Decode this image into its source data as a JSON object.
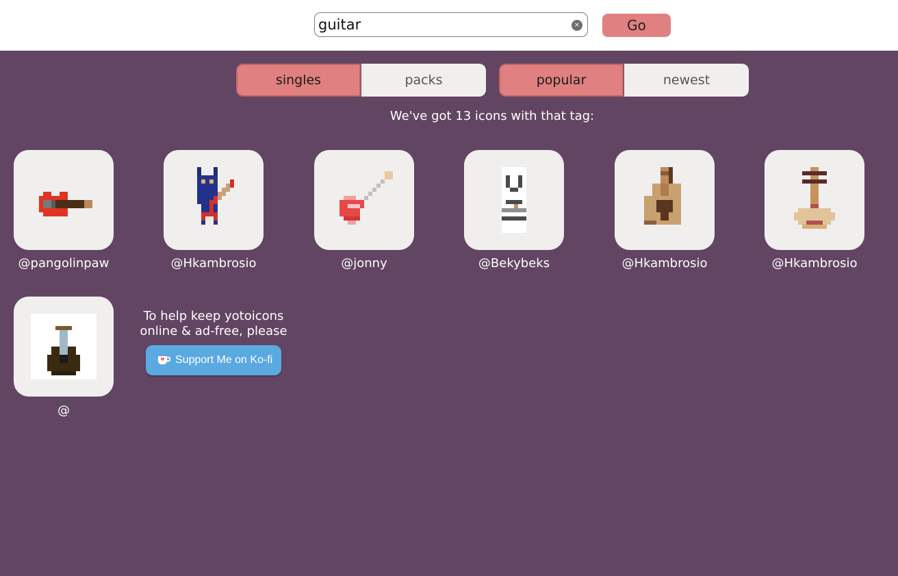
{
  "search": {
    "value": "guitar",
    "clear_icon": "×",
    "go_label": "Go"
  },
  "filters": {
    "kind": [
      {
        "label": "singles",
        "active": true
      },
      {
        "label": "packs",
        "active": false
      }
    ],
    "sort": [
      {
        "label": "popular",
        "active": true
      },
      {
        "label": "newest",
        "active": false
      }
    ]
  },
  "results_text": "We've got 13 icons with that tag:",
  "icons": [
    {
      "author": "@pangolinpaw",
      "icon": "red-electric-guitar-icon"
    },
    {
      "author": "@Hkambrosio",
      "icon": "cat-guitarist-icon"
    },
    {
      "author": "@jonny",
      "icon": "pink-electric-guitar-icon"
    },
    {
      "author": "@Bekybeks",
      "icon": "guitar-neck-icon"
    },
    {
      "author": "@Hkambrosio",
      "icon": "acoustic-guitar-icon"
    },
    {
      "author": "@Hkambrosio",
      "icon": "banjo-icon"
    },
    {
      "author": "@",
      "icon": "dark-guitar-icon"
    }
  ],
  "kofi": {
    "message_line1": "To help keep yotoicons",
    "message_line2": "online & ad-free, please",
    "button_label": "Support Me on Ko-fi"
  },
  "colors": {
    "background": "#624562",
    "accent": "#e08080",
    "tile": "#f1efee",
    "kofi": "#5aa9e0"
  }
}
